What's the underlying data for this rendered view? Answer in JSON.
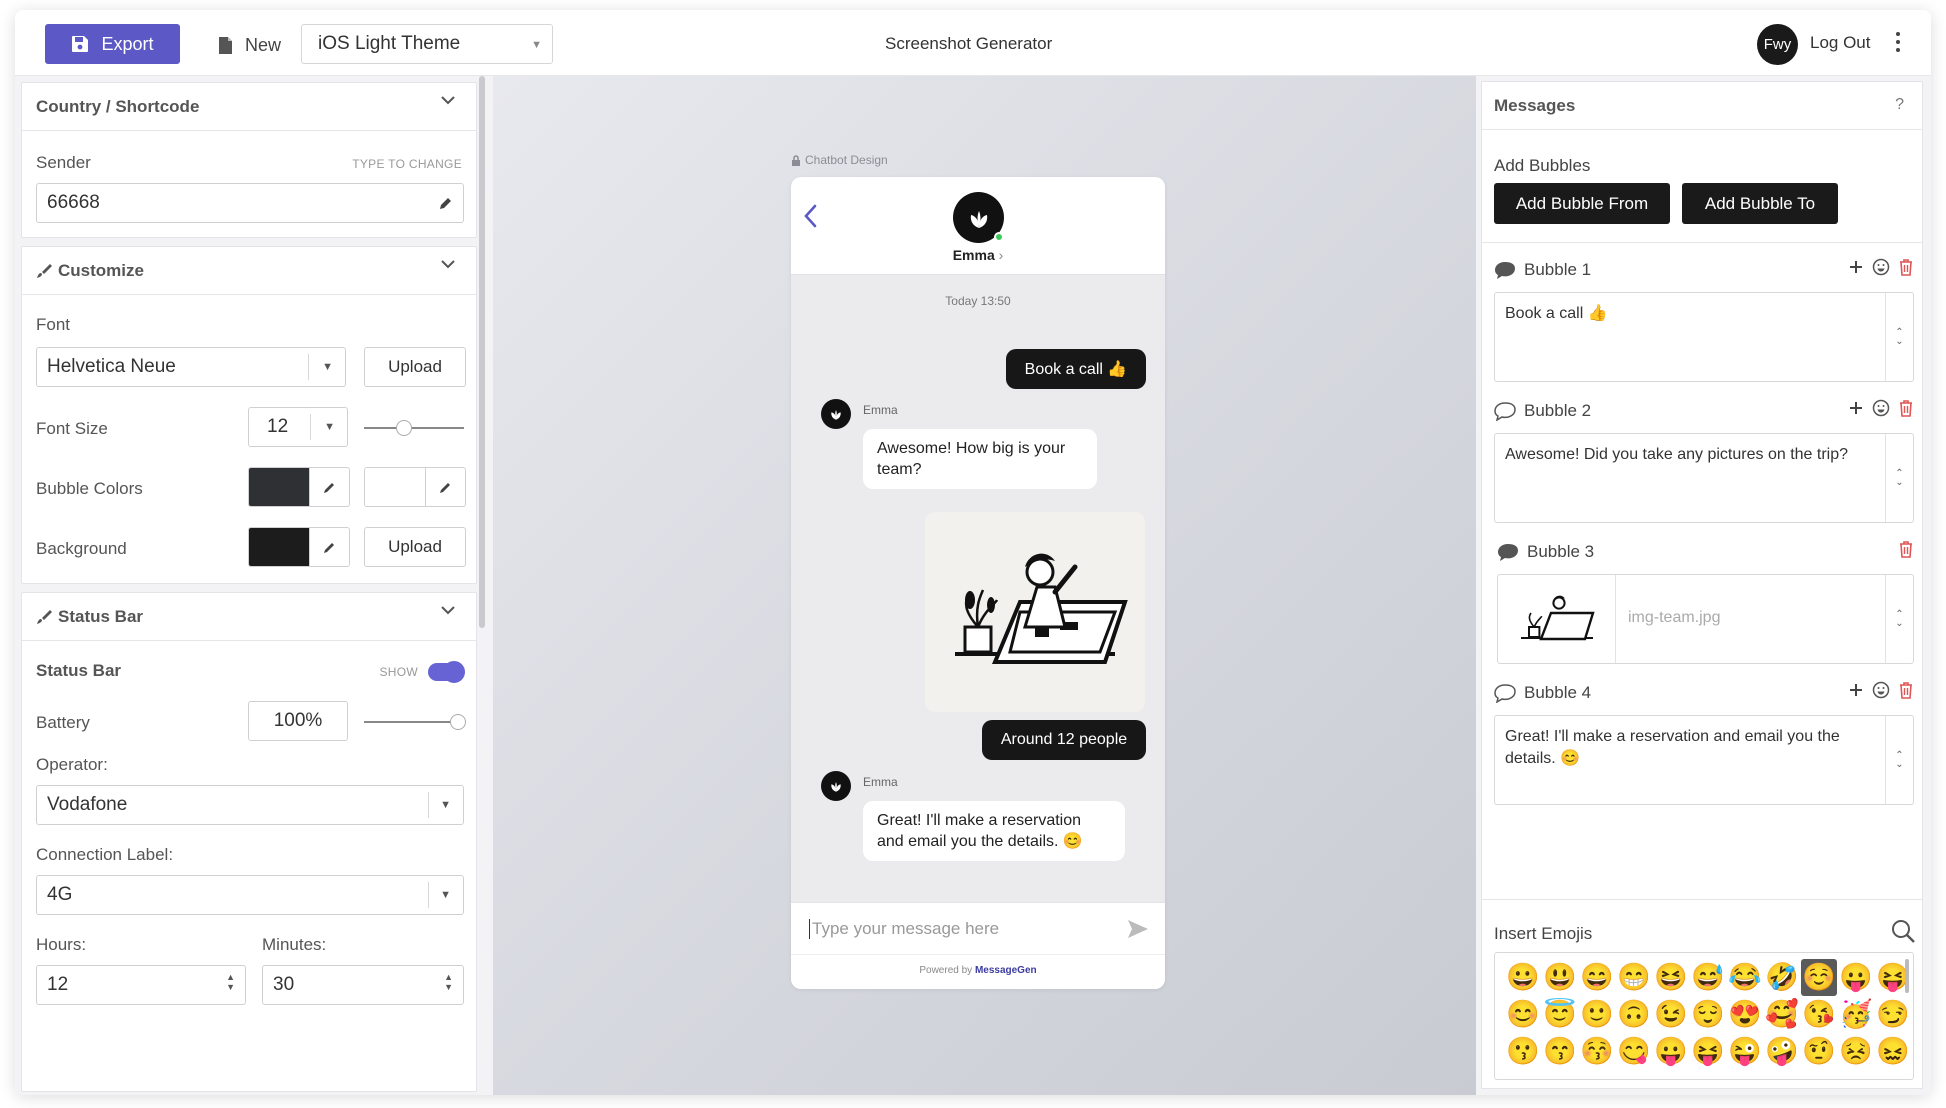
{
  "topbar": {
    "export_label": "Export",
    "new_label": "New",
    "theme_value": "iOS Light Theme",
    "app_title": "Screenshot Generator",
    "avatar_text": "Fwy",
    "logout_label": "Log Out"
  },
  "country": {
    "title": "Country / Shortcode",
    "sender_label": "Sender",
    "sender_hint": "TYPE TO CHANGE",
    "sender_value": "66668"
  },
  "customize": {
    "title": "Customize",
    "font_label": "Font",
    "font_value": "Helvetica Neue",
    "upload_label": "Upload",
    "font_size_label": "Font Size",
    "font_size_value": "12",
    "bubble_colors_label": "Bubble Colors",
    "bubble_color_from": "#2f3033",
    "bubble_color_to": "#ffffff",
    "background_label": "Background",
    "background_color": "#1c1c1c",
    "background_upload_label": "Upload"
  },
  "status_bar": {
    "title": "Status Bar",
    "status_bar_label": "Status Bar",
    "show_label": "SHOW",
    "battery_label": "Battery",
    "battery_value": "100%",
    "operator_label": "Operator:",
    "operator_value": "Vodafone",
    "connection_label": "Connection Label:",
    "connection_value": "4G",
    "hours_label": "Hours:",
    "hours_value": "12",
    "minutes_label": "Minutes:",
    "minutes_value": "30"
  },
  "preview": {
    "design_label": "Chatbot Design",
    "contact_name": "Emma",
    "timestamp": "Today 13:50",
    "messages": [
      {
        "dir": "out",
        "text": "Book a call 👍"
      },
      {
        "dir": "in",
        "sender": "Emma",
        "text": "Awesome! How big is your team?"
      },
      {
        "dir": "out-image"
      },
      {
        "dir": "out",
        "text": "Around 12 people"
      },
      {
        "dir": "in",
        "sender": "Emma",
        "text": "Great! I'll make a reservation and email you the details. 😊"
      }
    ],
    "input_placeholder": "Type your message here",
    "powered_by": "Powered by",
    "brand": "MessageGen"
  },
  "messages_panel": {
    "title": "Messages",
    "help": "?",
    "add_bubbles_label": "Add Bubbles",
    "add_from_label": "Add Bubble From",
    "add_to_label": "Add Bubble To",
    "bubbles": [
      {
        "label": "Bubble 1",
        "type": "from",
        "text": "Book a call 👍"
      },
      {
        "label": "Bubble 2",
        "type": "to",
        "text": "Awesome! Did you take any pictures on the trip?"
      },
      {
        "label": "Bubble 3",
        "type": "from",
        "image_name": "img-team.jpg"
      },
      {
        "label": "Bubble 4",
        "type": "to",
        "text": "Great! I'll make a reservation and email you the details. 😊"
      }
    ],
    "insert_emojis_label": "Insert Emojis",
    "emojis": [
      "😀",
      "😃",
      "😄",
      "😁",
      "😆",
      "😅",
      "😂",
      "🤣",
      "☺️",
      "😛",
      "😝",
      "😊",
      "😇",
      "🙂",
      "🙃",
      "😉",
      "😌",
      "😍",
      "🥰",
      "😘",
      "🥳",
      "😏",
      "😗",
      "😙",
      "😚",
      "😋",
      "😛",
      "😝",
      "😜",
      "🤪",
      "🤨",
      "😣",
      "😖"
    ],
    "selected_emoji": "☺️"
  },
  "colors": {
    "accent": "#5c58c6",
    "dark_bubble": "#171717",
    "danger": "#e05555"
  }
}
